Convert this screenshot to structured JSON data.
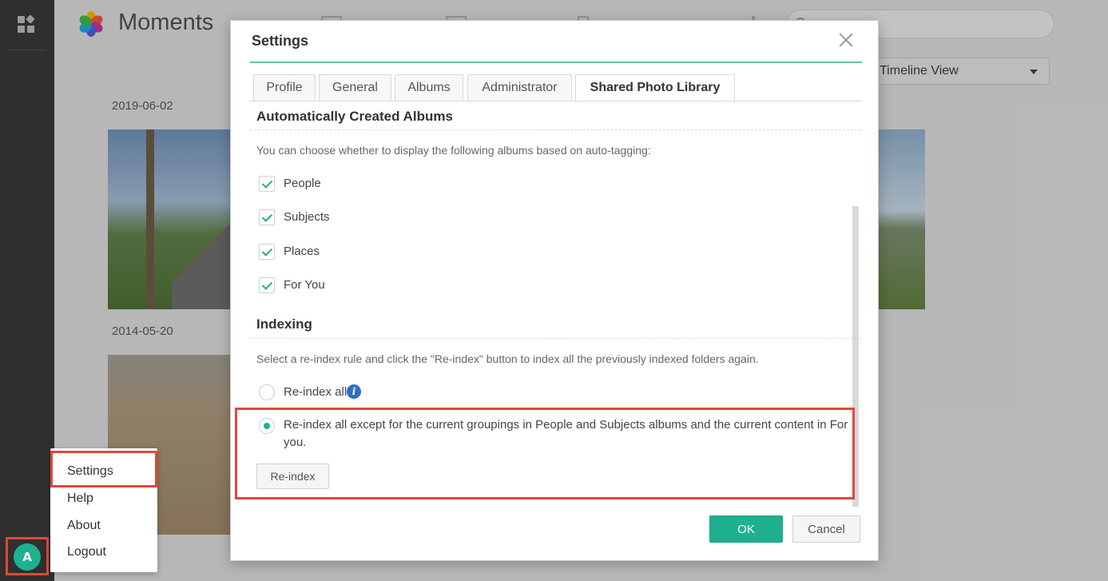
{
  "app": {
    "brand": "Moments",
    "view_select": "Timeline View",
    "dates": [
      "2019-06-02",
      "2014-05-20"
    ],
    "avatar_initial": "A"
  },
  "menu": {
    "items": [
      "Settings",
      "Help",
      "About",
      "Logout"
    ]
  },
  "dialog": {
    "title": "Settings",
    "tabs": [
      "Profile",
      "General",
      "Albums",
      "Administrator",
      "Shared Photo Library"
    ],
    "active_tab": "Shared Photo Library",
    "auto_albums": {
      "heading": "Automatically Created Albums",
      "description": "You can choose whether to display the following albums based on auto-tagging:",
      "options": [
        {
          "label": "People",
          "checked": true
        },
        {
          "label": "Subjects",
          "checked": true
        },
        {
          "label": "Places",
          "checked": true
        },
        {
          "label": "For You",
          "checked": true
        }
      ]
    },
    "indexing": {
      "heading": "Indexing",
      "description": "Select a re-index rule and click the \"Re-index\" button to index all the previously indexed folders again.",
      "options": [
        {
          "label": "Re-index all",
          "selected": false
        },
        {
          "label": "Re-index all except for the current groupings in People and Subjects albums and the current content in For you.",
          "selected": true
        }
      ],
      "button": "Re-index"
    },
    "ok": "OK",
    "cancel": "Cancel"
  },
  "colors": {
    "accent": "#1fb08f",
    "highlight": "#e0483a",
    "info": "#2f6fc0"
  }
}
